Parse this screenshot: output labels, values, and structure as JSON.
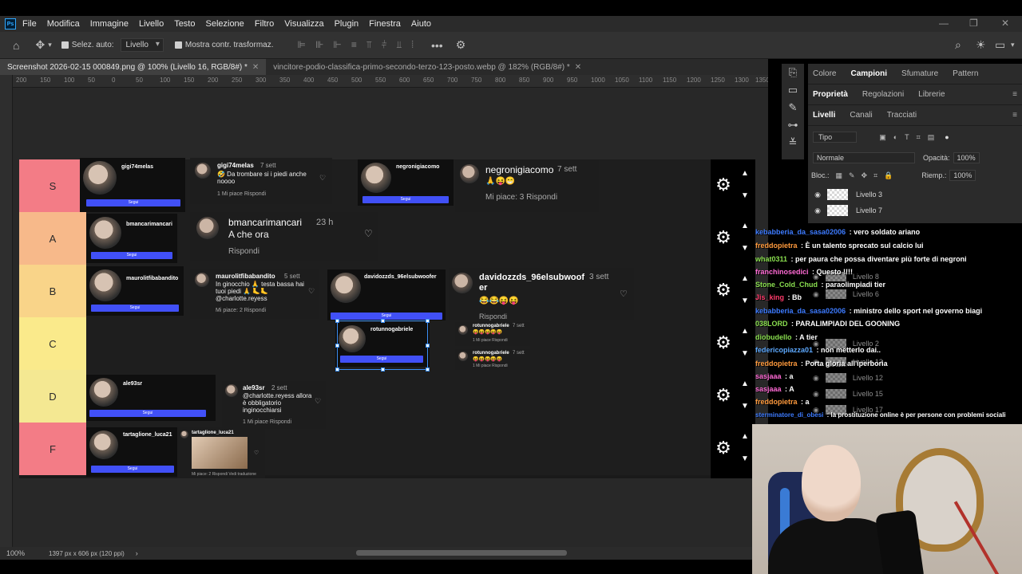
{
  "menubar": {
    "logo": "Ps",
    "items": [
      "File",
      "Modifica",
      "Immagine",
      "Livello",
      "Testo",
      "Selezione",
      "Filtro",
      "Visualizza",
      "Plugin",
      "Finestra",
      "Aiuto"
    ]
  },
  "options": {
    "auto_select_label": "Selez. auto:",
    "auto_select_value": "Livello",
    "show_transform_label": "Mostra contr. trasformaz."
  },
  "tabs": [
    {
      "title": "Screenshot 2026-02-15 000849.png @ 100% (Livello 16, RGB/8#) *",
      "active": true
    },
    {
      "title": "vincitore-podio-classifica-primo-secondo-terzo-123-posto.webp @ 182% (RGB/8#) *",
      "active": false
    }
  ],
  "ruler": {
    "ticks": [
      "200",
      "150",
      "100",
      "50",
      "0",
      "50",
      "100",
      "150",
      "200",
      "250",
      "300",
      "350",
      "400",
      "450",
      "500",
      "550",
      "600",
      "650",
      "700",
      "750",
      "800",
      "850",
      "900",
      "950",
      "1000",
      "1050",
      "1100",
      "1150",
      "1200",
      "1250",
      "1300",
      "1350"
    ]
  },
  "tiers": [
    {
      "label": "S",
      "color": "#f37c86"
    },
    {
      "label": "A",
      "color": "#f7b98a"
    },
    {
      "label": "B",
      "color": "#f9d489"
    },
    {
      "label": "C",
      "color": "#faea8b"
    },
    {
      "label": "D",
      "color": "#f4e892"
    },
    {
      "label": "F",
      "color": "#f37c86"
    }
  ],
  "cards": {
    "s_profile1": {
      "name": "gigi74melas",
      "follow": "Segui"
    },
    "s_comment1": {
      "user": "gigi74melas",
      "time": "7 sett",
      "text": "🤣 Da trombare si i piedi anche noooo",
      "meta": "1 Mi piace   Rispondi"
    },
    "s_profile2": {
      "name": "negronigiacomo",
      "follow": "Segui"
    },
    "s_comment2": {
      "user": "negronigiacomo",
      "time": "7 sett",
      "text": "🙏😝😁",
      "meta": "Mi piace: 3   Rispondi"
    },
    "a_profile": {
      "name": "bmancarimancari",
      "follow": "Segui"
    },
    "a_comment": {
      "user": "bmancarimancari",
      "time": "23 h",
      "text": "A che ora",
      "meta": "Rispondi"
    },
    "b_profile1": {
      "name": "maurolitfibabandito",
      "follow": "Segui"
    },
    "b_comment1": {
      "user": "maurolitfibabandito",
      "time": "5 sett",
      "text": "In ginocchio 🙏 testa bassa hai tuoi piedi 🙏 🦶🦶 @charlotte.reyess",
      "meta": "Mi piace: 2   Rispondi"
    },
    "b_profile2": {
      "name": "davidozzds_96elsubwoofer",
      "follow": "Segui"
    },
    "b_comment2": {
      "user": "davidozzds_96elsubwoof er",
      "time": "3 sett",
      "text": "😂😂😝😝",
      "meta": "Rispondi"
    },
    "c_profile": {
      "name": "rotunnogabriele",
      "follow": "Segui"
    },
    "c_comment1": {
      "user": "rotunnogabriele",
      "time": "7 sett",
      "text": "😝😝😝😝😝",
      "meta": "1 Mi piace   Rispondi"
    },
    "c_comment2": {
      "user": "rotunnogabriele",
      "time": "7 sett",
      "text": "😝😝😝😝😝",
      "meta": "1 Mi piace   Rispondi"
    },
    "d_profile": {
      "name": "ale93sr",
      "follow": "Segui"
    },
    "d_comment": {
      "user": "ale93sr",
      "time": "2 sett",
      "text": "@charlotte.reyess allora è obbligatorio inginocchiarsi",
      "meta": "1 Mi piace   Rispondi"
    },
    "f_profile": {
      "name": "tartaglione_luca21",
      "follow": "Segui"
    },
    "f_comment": {
      "user": "tartaglione_luca21",
      "time": "",
      "text": "",
      "meta": "Mi piace: 2   Rispondi   Vedi traduzione"
    }
  },
  "status": {
    "zoom": "100%",
    "doc_info": "1397 px x 606 px (120 ppi)"
  },
  "panels": {
    "row1_tabs": [
      "Colore",
      "Campioni",
      "Sfumature",
      "Pattern"
    ],
    "row2_tabs": [
      "Proprietà",
      "Regolazioni",
      "Librerie"
    ],
    "row3_tabs": [
      "Livelli",
      "Canali",
      "Tracciati"
    ],
    "filter_kind": "Tipo",
    "blend_mode": "Normale",
    "opacity_label": "Opacità:",
    "opacity_value": "100%",
    "lock_label": "Bloc.:",
    "fill_label": "Riemp.:",
    "fill_value": "100%",
    "layers": [
      "Livello 3",
      "Livello 7"
    ]
  },
  "ghost_layers": [
    "Livello 8",
    "Livello 6",
    "Livello 2",
    "Livello 13",
    "Livello 12",
    "Livello 15",
    "Livello 17"
  ],
  "chat": [
    {
      "user": "kebabberia_da_sasa02006",
      "color": "#3d7bff",
      "text": " : vero soldato ariano"
    },
    {
      "user": "freddopietra",
      "color": "#ff9a3d",
      "text": " : È un talento sprecato sul calcio lui"
    },
    {
      "user": "what0311",
      "color": "#8adf4f",
      "text": " : per paura che possa diventare più forte di negroni"
    },
    {
      "user": "franchinosedici",
      "color": "#ff6ad5",
      "text": " : Questo !!!!"
    },
    {
      "user": "Stone_Cold_Chud",
      "color": "#8adf4f",
      "text": " : paraolimpiadi tier"
    },
    {
      "user": "Jis_king",
      "color": "#ff3b6b",
      "text": " : Bb"
    },
    {
      "user": "kebabberia_da_sasa02006",
      "color": "#3d7bff",
      "text": " : ministro dello sport nel governo biagi"
    },
    {
      "user": "038LORD",
      "color": "#8adf4f",
      "text": " : PARALIMPIADI DEL GOONING"
    },
    {
      "user": "diobudello",
      "color": "#8adf4f",
      "text": " : A tier"
    },
    {
      "user": "federicopiazza01",
      "color": "#5da9ff",
      "text": " : non metterlo dai.."
    },
    {
      "user": "freddopietra",
      "color": "#ff9a3d",
      "text": " : Porta gloria all'iperboria"
    },
    {
      "user": "sasjaaa",
      "color": "#ff6ad5",
      "text": " : a"
    },
    {
      "user": "sasjaaa",
      "color": "#ff6ad5",
      "text": " : A"
    },
    {
      "user": "freddopietra",
      "color": "#ff9a3d",
      "text": " : a"
    },
    {
      "user": "sterminatore_di_obesi",
      "color": "#3d7bff",
      "text": " : la prostituzione online è per persone con problemi sociali"
    }
  ]
}
